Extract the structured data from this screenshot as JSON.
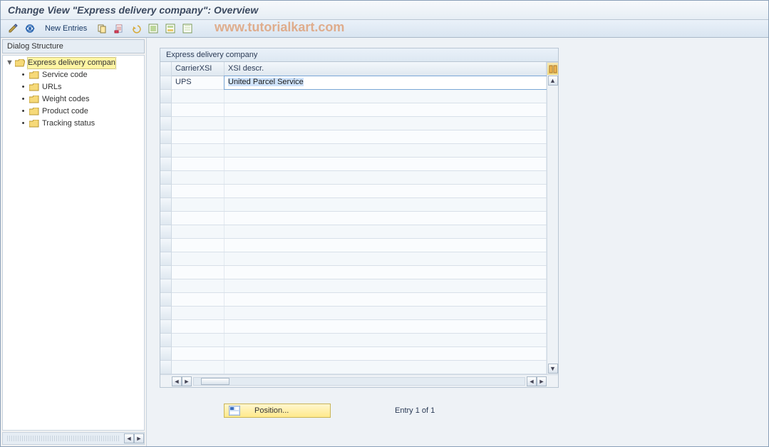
{
  "title": "Change View \"Express delivery company\": Overview",
  "watermark": "www.tutorialkart.com",
  "toolbar": {
    "new_entries_label": "New Entries"
  },
  "tree": {
    "header": "Dialog Structure",
    "root": {
      "label": "Express delivery compan",
      "children": [
        {
          "label": "Service code"
        },
        {
          "label": "URLs"
        },
        {
          "label": "Weight codes"
        },
        {
          "label": "Product code"
        },
        {
          "label": "Tracking status"
        }
      ]
    }
  },
  "group": {
    "title": "Express delivery company",
    "columns": {
      "c1": "CarrierXSI",
      "c2": "XSI descr."
    },
    "rows": [
      {
        "c1": "UPS",
        "c2": "United Parcel Service"
      }
    ],
    "empty_rows": 21
  },
  "footer": {
    "position_label": "Position...",
    "entry_text": "Entry 1 of 1"
  }
}
